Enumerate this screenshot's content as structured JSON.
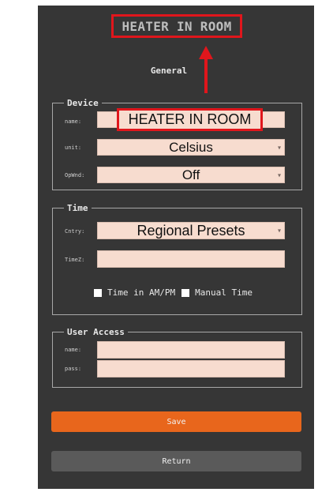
{
  "header": {
    "title": "HEATER IN ROOM"
  },
  "general": {
    "heading": "General"
  },
  "device": {
    "legend": "Device",
    "name_label": "name:",
    "name_value": "HEATER IN ROOM",
    "unit_label": "unit:",
    "unit_value": "Celsius",
    "opmode_label": "OpWnd:",
    "opmode_value": "Off"
  },
  "time": {
    "legend": "Time",
    "country_label": "Cntry:",
    "country_value": "Regional Presets",
    "timezone_label": "TimeZ:",
    "timezone_value": "",
    "ampm_label": "Time in AM/PM",
    "manual_label": "Manual Time"
  },
  "user_access": {
    "legend": "User Access",
    "name_label": "name:",
    "name_value": "",
    "pass_label": "pass:",
    "pass_value": ""
  },
  "buttons": {
    "save": "Save",
    "return": "Return"
  },
  "colors": {
    "annotation": "#e0161c",
    "save": "#e8661c",
    "return": "#5a5a5a",
    "panel": "#363636",
    "field": "#f7dccf"
  },
  "icons": {
    "arrow": "up-arrow-annotation",
    "dropdown": "chevron-down-icon",
    "checkbox": "checkbox-icon"
  }
}
